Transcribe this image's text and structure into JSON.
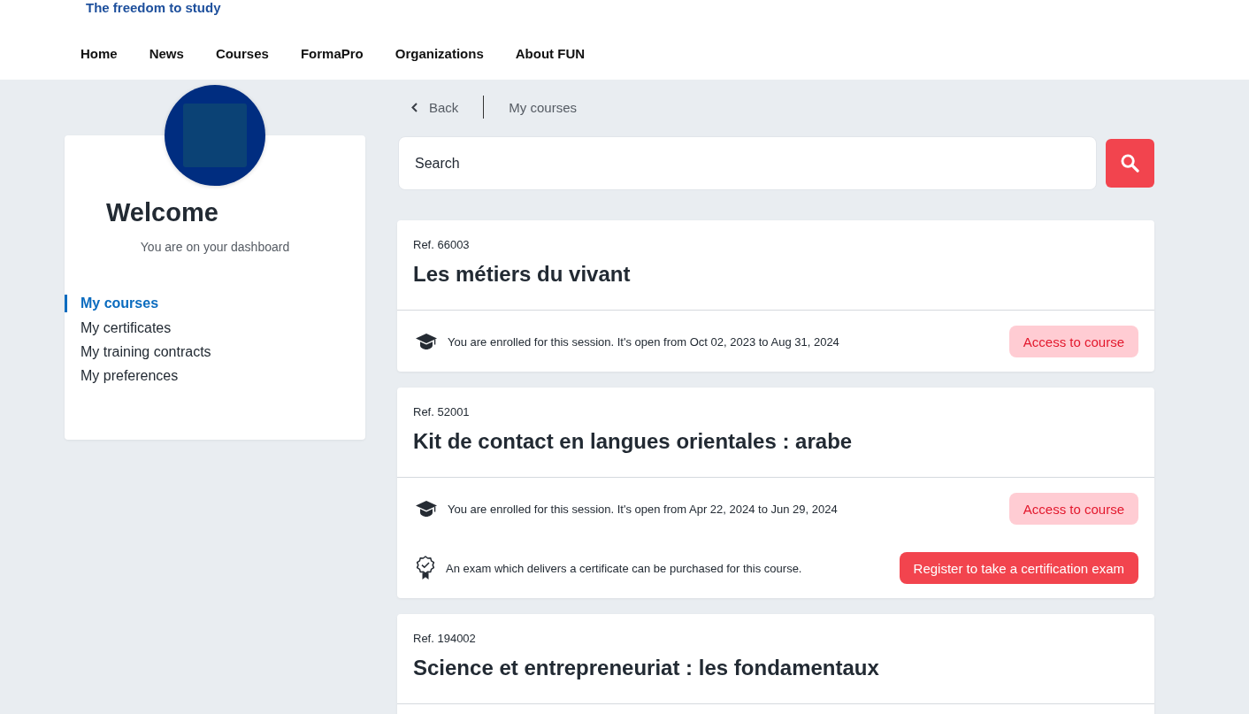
{
  "header": {
    "tagline": "The freedom to study",
    "nav": [
      {
        "label": "Home"
      },
      {
        "label": "News"
      },
      {
        "label": "Courses"
      },
      {
        "label": "FormaPro"
      },
      {
        "label": "Organizations"
      },
      {
        "label": "About FUN"
      }
    ]
  },
  "sidebar": {
    "title": "Welcome",
    "subtitle": "You are on your dashboard",
    "items": [
      {
        "label": "My courses",
        "selected": true
      },
      {
        "label": "My certificates",
        "selected": false
      },
      {
        "label": "My training contracts",
        "selected": false
      },
      {
        "label": "My preferences",
        "selected": false
      }
    ]
  },
  "breadcrumb": {
    "back": "Back",
    "current": "My courses"
  },
  "search": {
    "placeholder": "Search"
  },
  "courses": [
    {
      "ref": "Ref. 66003",
      "title": "Les métiers du vivant",
      "rows": [
        {
          "kind": "session",
          "text": "You are enrolled for this session. It's open from Oct 02, 2023 to Aug 31, 2024",
          "button": "Access to course"
        }
      ]
    },
    {
      "ref": "Ref. 52001",
      "title": "Kit de contact en langues orientales : arabe",
      "rows": [
        {
          "kind": "session",
          "text": "You are enrolled for this session. It's open from Apr 22, 2024 to Jun 29, 2024",
          "button": "Access to course"
        },
        {
          "kind": "exam",
          "text": "An exam which delivers a certificate can be purchased for this course.",
          "button": "Register to take a certification exam"
        }
      ]
    },
    {
      "ref": "Ref. 194002",
      "title": "Science et entrepreneuriat : les fondamentaux"
    }
  ]
}
